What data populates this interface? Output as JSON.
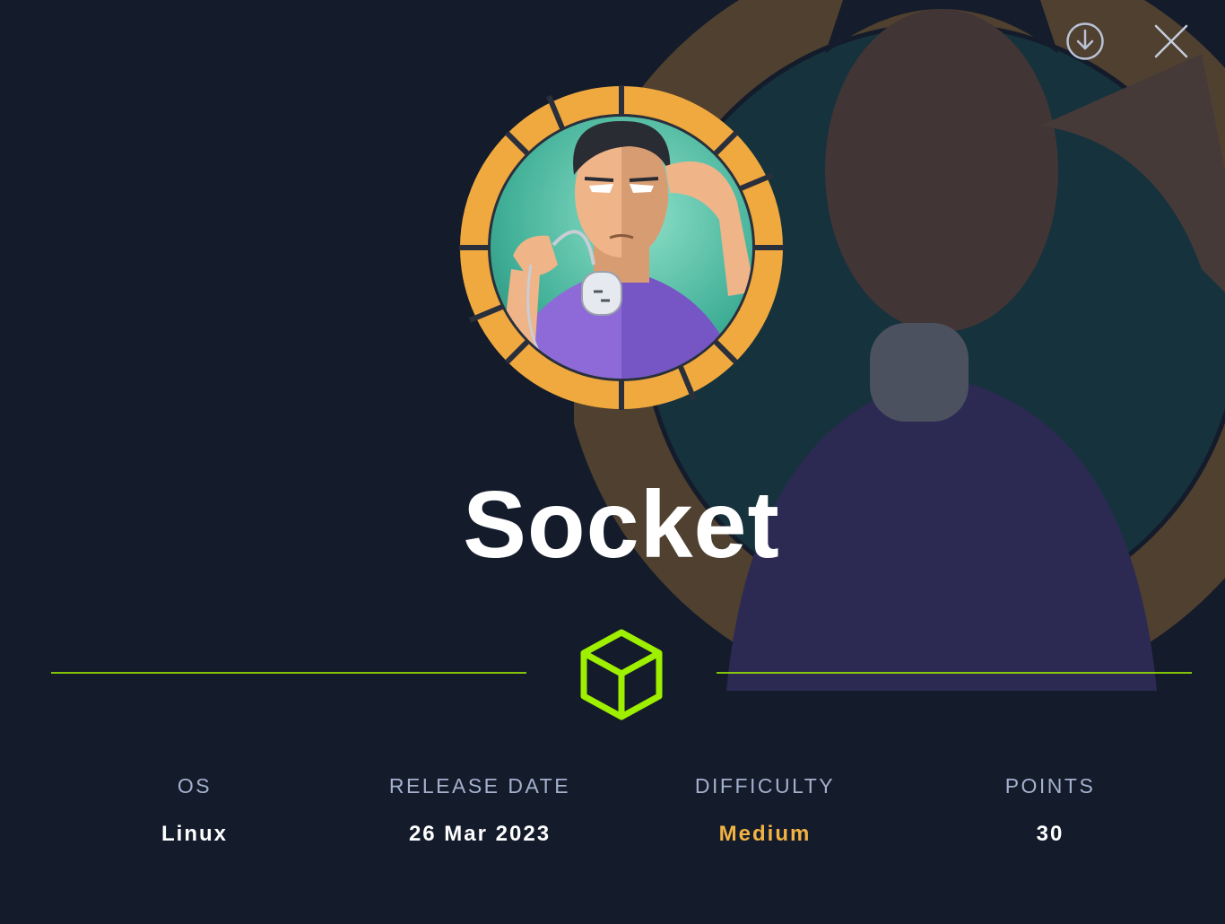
{
  "machine": {
    "name": "Socket",
    "icon": "socket-avatar"
  },
  "actions": {
    "download_icon": "download-icon",
    "close_icon": "close-icon"
  },
  "stats": {
    "os": {
      "label": "OS",
      "value": "Linux"
    },
    "release_date": {
      "label": "RELEASE DATE",
      "value": "26 Mar 2023"
    },
    "difficulty": {
      "label": "DIFFICULTY",
      "value": "Medium"
    },
    "points": {
      "label": "POINTS",
      "value": "30"
    }
  },
  "colors": {
    "background": "#141b2b",
    "accent_green": "#9fef00",
    "medium_orange": "#f2b243",
    "ring_orange": "#f0a93e",
    "label_gray": "#a4b1cd"
  }
}
